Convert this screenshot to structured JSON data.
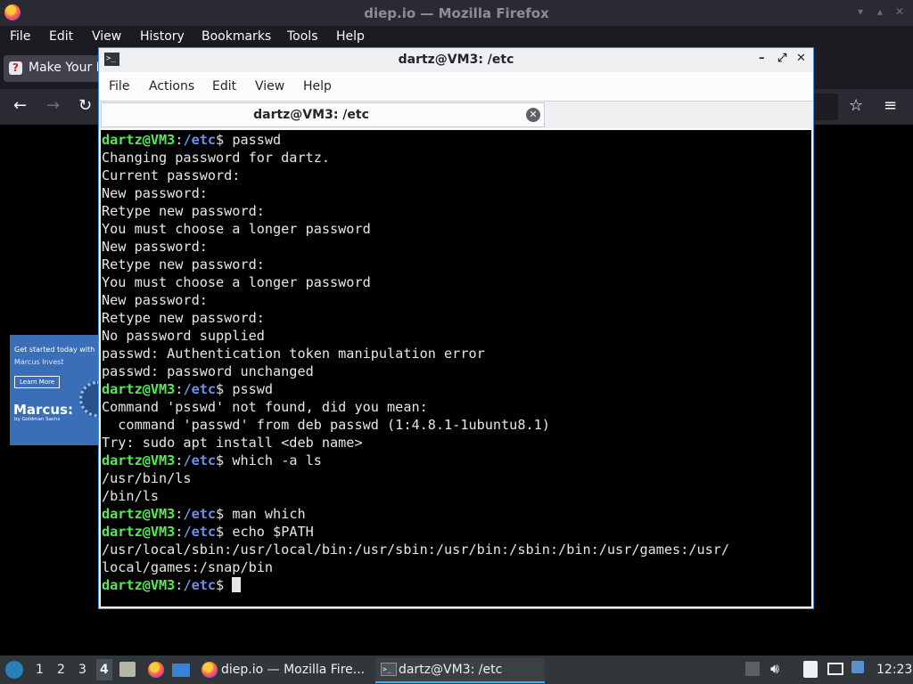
{
  "firefox": {
    "window_title": "diep.io — Mozilla Firefox",
    "menu": [
      "File",
      "Edit",
      "View",
      "History",
      "Bookmarks",
      "Tools",
      "Help"
    ],
    "tab_label": "Make Your P",
    "ad": {
      "line1": "Get started today with",
      "line2": "Marcus Invest",
      "button": "Learn More",
      "brand": "Marcus:",
      "brand_sub": "by Goldman Sachs"
    }
  },
  "terminal": {
    "window_title": "dartz@VM3: /etc",
    "menu": [
      "File",
      "Actions",
      "Edit",
      "View",
      "Help"
    ],
    "tab_label": "dartz@VM3: /etc",
    "prompt_user": "dartz@VM3",
    "prompt_path": "/etc",
    "lines": [
      {
        "type": "cmd",
        "text": "passwd"
      },
      {
        "type": "out",
        "text": "Changing password for dartz."
      },
      {
        "type": "out",
        "text": "Current password:"
      },
      {
        "type": "out",
        "text": "New password:"
      },
      {
        "type": "out",
        "text": "Retype new password:"
      },
      {
        "type": "out",
        "text": "You must choose a longer password"
      },
      {
        "type": "out",
        "text": "New password:"
      },
      {
        "type": "out",
        "text": "Retype new password:"
      },
      {
        "type": "out",
        "text": "You must choose a longer password"
      },
      {
        "type": "out",
        "text": "New password:"
      },
      {
        "type": "out",
        "text": "Retype new password:"
      },
      {
        "type": "out",
        "text": "No password supplied"
      },
      {
        "type": "out",
        "text": "passwd: Authentication token manipulation error"
      },
      {
        "type": "out",
        "text": "passwd: password unchanged"
      },
      {
        "type": "cmd",
        "text": "psswd"
      },
      {
        "type": "out",
        "text": "Command 'psswd' not found, did you mean:"
      },
      {
        "type": "out",
        "text": "  command 'passwd' from deb passwd (1:4.8.1-1ubuntu8.1)"
      },
      {
        "type": "out",
        "text": "Try: sudo apt install <deb name>"
      },
      {
        "type": "cmd",
        "text": "which -a ls"
      },
      {
        "type": "out",
        "text": "/usr/bin/ls"
      },
      {
        "type": "out",
        "text": "/bin/ls"
      },
      {
        "type": "cmd",
        "text": "man which"
      },
      {
        "type": "cmd",
        "text": "echo $PATH"
      },
      {
        "type": "out",
        "text": "/usr/local/sbin:/usr/local/bin:/usr/sbin:/usr/bin:/sbin:/bin:/usr/games:/usr/"
      },
      {
        "type": "out",
        "text": "local/games:/snap/bin"
      },
      {
        "type": "cmd",
        "text": "",
        "cursor": true
      }
    ]
  },
  "taskbar": {
    "workspaces": [
      "1",
      "2",
      "3",
      "4"
    ],
    "active_workspace": "4",
    "windows": [
      {
        "label": "diep.io — Mozilla Fire...",
        "icon": "firefox-icon"
      },
      {
        "label": "dartz@VM3: /etc",
        "icon": "terminal-icon"
      }
    ],
    "clock": "12:23"
  }
}
